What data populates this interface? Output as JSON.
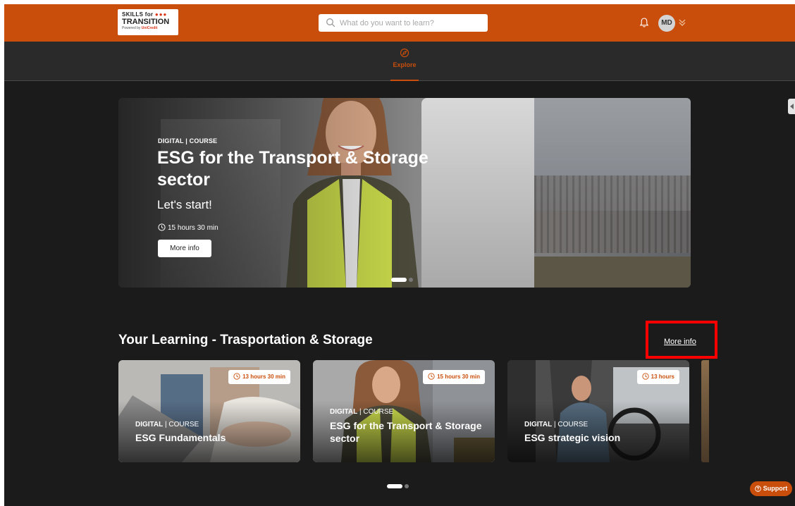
{
  "brand": {
    "line1": "SKILLS for",
    "line1_dots": "●●●",
    "line2": "TRANSITION",
    "line3_prefix": "Powered by",
    "line3_brand": "UniCredit"
  },
  "search": {
    "placeholder": "What do you want to learn?",
    "value": ""
  },
  "user": {
    "initials": "MD"
  },
  "nav": {
    "explore_label": "Explore"
  },
  "hero": {
    "kicker": "DIGITAL | COURSE",
    "title": "ESG for the Transport & Storage sector",
    "subtitle": "Let's start!",
    "duration": "15 hours 30 min",
    "button_label": "More info"
  },
  "section": {
    "title": "Your Learning - Trasportation & Storage",
    "more_label": "More info"
  },
  "cards": [
    {
      "kicker_type": "DIGITAL",
      "kicker_sep": " | ",
      "kicker_kind": "COURSE",
      "title": "ESG Fundamentals",
      "duration": "13 hours 30 min"
    },
    {
      "kicker_type": "DIGITAL",
      "kicker_sep": " | ",
      "kicker_kind": "COURSE",
      "title": "ESG for the Transport & Storage sector",
      "duration": "15 hours 30 min"
    },
    {
      "kicker_type": "DIGITAL",
      "kicker_sep": " | ",
      "kicker_kind": "COURSE",
      "title": "ESG strategic vision",
      "duration": "13 hours"
    }
  ],
  "support": {
    "label": "Support"
  },
  "colors": {
    "accent": "#c94e0b",
    "background": "#1b1b1b",
    "highlight": "#ff0000"
  },
  "icons": [
    "search-icon",
    "bell-icon",
    "chevron-down-icon",
    "explore-icon",
    "clock-icon",
    "help-icon",
    "chevron-left-icon"
  ]
}
